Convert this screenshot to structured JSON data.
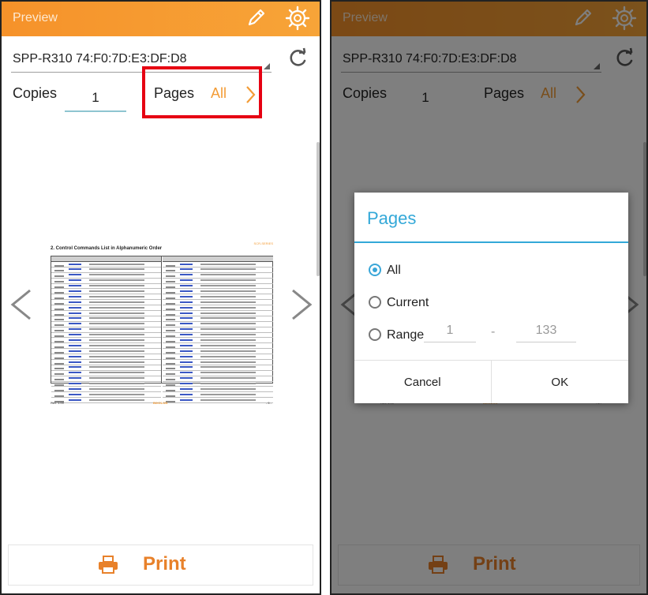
{
  "app": {
    "title": "Preview"
  },
  "device": {
    "name": "SPP-R310 74:F0:7D:E3:DF:D8"
  },
  "copies": {
    "label": "Copies",
    "value": "1"
  },
  "pages": {
    "label": "Pages",
    "value": "All"
  },
  "print": {
    "label": "Print"
  },
  "document": {
    "tag": "SCR-SERIES",
    "heading": "2. Control Commands List in Alphanumeric Order",
    "footer_left": "Rev. 1.00",
    "footer_center": "BIXOLON",
    "footer_right": "- 6 -"
  },
  "dialog": {
    "title": "Pages",
    "options": [
      "All",
      "Current",
      "Range"
    ],
    "selected": "All",
    "range_from": "1",
    "range_separator": "-",
    "range_to": "133",
    "cancel_label": "Cancel",
    "ok_label": "OK"
  },
  "colors": {
    "accent": "#f39c36",
    "dialog_accent": "#33a8d8",
    "highlight": "#e60012"
  }
}
